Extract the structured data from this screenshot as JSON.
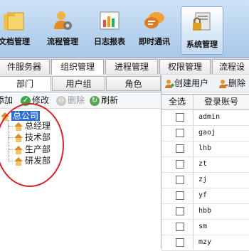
{
  "toolbar": {
    "items": [
      {
        "label": "文档管理",
        "icon": "folder-icon"
      },
      {
        "label": "流程管理",
        "icon": "workflow-person-icon"
      },
      {
        "label": "日志报表",
        "icon": "bar-chart-icon"
      },
      {
        "label": "即时通讯",
        "icon": "chat-bubbles-icon"
      },
      {
        "label": "系统管理",
        "icon": "system-lock-icon"
      }
    ],
    "active_index": 4
  },
  "module_tabs": [
    "件服务器",
    "组织管理",
    "进程管理",
    "权限管理",
    "流程设"
  ],
  "module_tabs_selected": 1,
  "left_tabs": [
    "部门",
    "用户组",
    "角色"
  ],
  "left_tabs_selected": 0,
  "left_actions": {
    "add": "添加",
    "edit": "修改",
    "delete": "删除",
    "refresh": "刷新"
  },
  "tree": {
    "root": "总公司",
    "children": [
      "总经理",
      "技术部",
      "生产部",
      "研发部"
    ]
  },
  "right_actions": {
    "create_user": "创建用户",
    "delete": "删除"
  },
  "user_table": {
    "headers": [
      "全选",
      "登录账号"
    ],
    "rows": [
      "admin",
      "gaoj",
      "lhb",
      "zt",
      "zj",
      "yf",
      "hbb",
      "sm",
      "mzy"
    ]
  },
  "colors": {
    "accent": "#2f6fd1",
    "annotation": "#d9232a",
    "toolbar": "#b8d3ee"
  }
}
